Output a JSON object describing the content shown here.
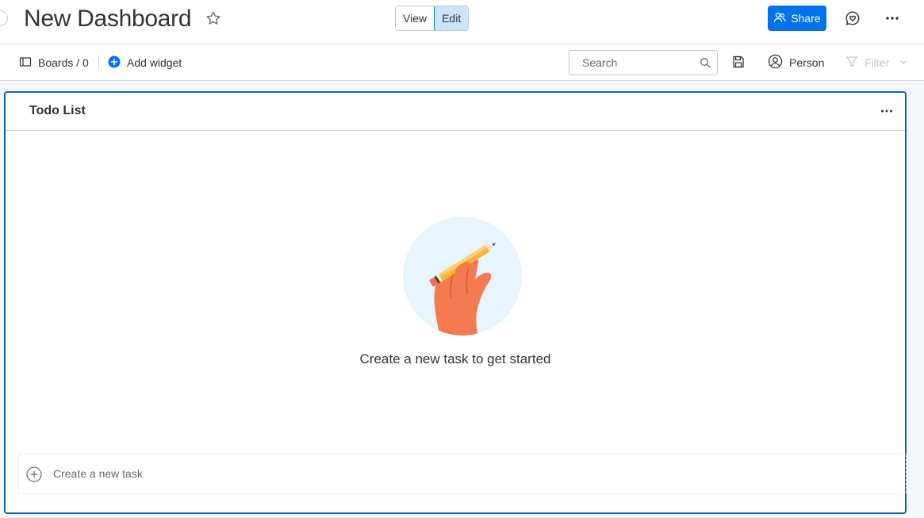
{
  "header": {
    "title": "New Dashboard",
    "view_label": "View",
    "edit_label": "Edit",
    "active_mode": "Edit",
    "share_label": "Share"
  },
  "toolbar": {
    "boards_label": "Boards / 0",
    "add_widget_label": "Add widget",
    "search_placeholder": "Search",
    "person_label": "Person",
    "filter_label": "Filter"
  },
  "widget": {
    "title": "Todo List",
    "empty_message": "Create a new task to get started",
    "new_task_placeholder": "Create a new task"
  },
  "colors": {
    "primary": "#0073ea",
    "edit_active_bg": "#cce5ff",
    "widget_border": "#0b63c5",
    "illustration_bg": "#e5f4ff",
    "hand": "#f47a4f",
    "pencil": "#fdb63c"
  },
  "icons": {
    "star": "star-icon",
    "share": "people-icon",
    "updates": "heart-chat-icon",
    "more": "more-horizontal-icon",
    "boards": "board-panel-icon",
    "add_widget": "plus-circle-icon",
    "search": "search-icon",
    "save": "save-icon",
    "person": "person-icon",
    "filter": "filter-icon"
  }
}
